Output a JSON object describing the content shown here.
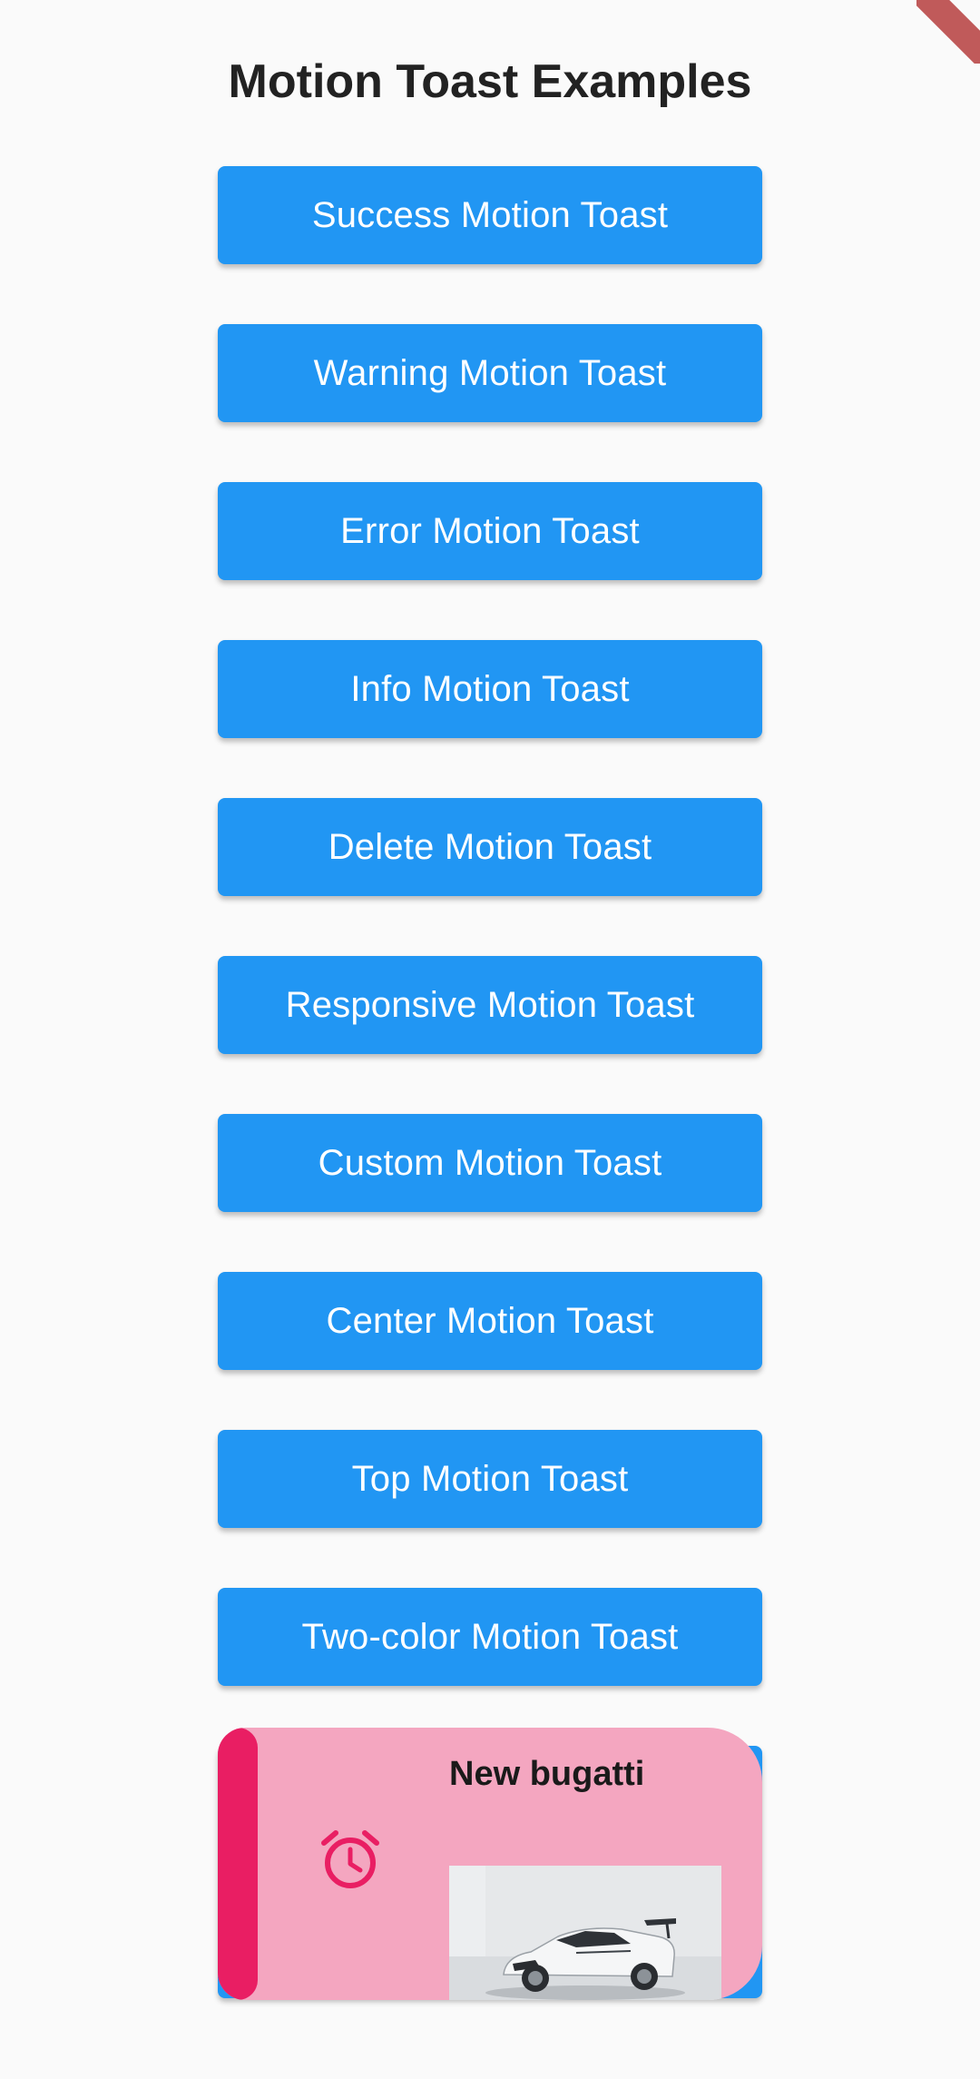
{
  "page": {
    "title": "Motion Toast Examples"
  },
  "buttons": [
    {
      "label": "Success Motion Toast"
    },
    {
      "label": "Warning Motion Toast"
    },
    {
      "label": "Error Motion Toast"
    },
    {
      "label": "Info Motion Toast"
    },
    {
      "label": "Delete Motion Toast"
    },
    {
      "label": "Responsive Motion Toast"
    },
    {
      "label": "Custom Motion Toast"
    },
    {
      "label": "Center Motion Toast"
    },
    {
      "label": "Top Motion Toast"
    },
    {
      "label": "Two-color Motion Toast"
    }
  ],
  "toast": {
    "title": "New bugatti",
    "icon": "alarm-clock-icon",
    "image": "car-image"
  },
  "colors": {
    "button": "#2196f3",
    "toast_background": "#f4a6c0",
    "toast_accent": "#e91e63",
    "debug_banner": "#b94a4a"
  }
}
